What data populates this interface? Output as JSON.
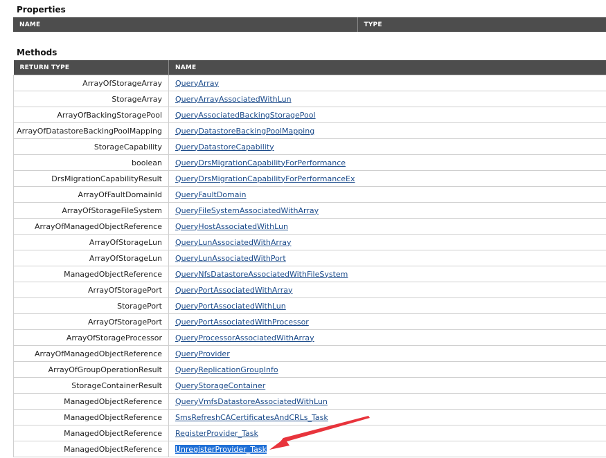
{
  "properties": {
    "title": "Properties",
    "columns": [
      "NAME",
      "TYPE"
    ]
  },
  "methods": {
    "title": "Methods",
    "columns": [
      "RETURN TYPE",
      "NAME"
    ],
    "rows": [
      {
        "return_type": "ArrayOfStorageArray",
        "name": "QueryArray"
      },
      {
        "return_type": "StorageArray",
        "name": "QueryArrayAssociatedWithLun"
      },
      {
        "return_type": "ArrayOfBackingStoragePool",
        "name": "QueryAssociatedBackingStoragePool"
      },
      {
        "return_type": "ArrayOfDatastoreBackingPoolMapping",
        "name": "QueryDatastoreBackingPoolMapping"
      },
      {
        "return_type": "StorageCapability",
        "name": "QueryDatastoreCapability"
      },
      {
        "return_type": "boolean",
        "name": "QueryDrsMigrationCapabilityForPerformance"
      },
      {
        "return_type": "DrsMigrationCapabilityResult",
        "name": "QueryDrsMigrationCapabilityForPerformanceEx"
      },
      {
        "return_type": "ArrayOfFaultDomainId",
        "name": "QueryFaultDomain"
      },
      {
        "return_type": "ArrayOfStorageFileSystem",
        "name": "QueryFileSystemAssociatedWithArray"
      },
      {
        "return_type": "ArrayOfManagedObjectReference",
        "name": "QueryHostAssociatedWithLun"
      },
      {
        "return_type": "ArrayOfStorageLun",
        "name": "QueryLunAssociatedWithArray"
      },
      {
        "return_type": "ArrayOfStorageLun",
        "name": "QueryLunAssociatedWithPort"
      },
      {
        "return_type": "ManagedObjectReference",
        "name": "QueryNfsDatastoreAssociatedWithFileSystem"
      },
      {
        "return_type": "ArrayOfStoragePort",
        "name": "QueryPortAssociatedWithArray"
      },
      {
        "return_type": "StoragePort",
        "name": "QueryPortAssociatedWithLun"
      },
      {
        "return_type": "ArrayOfStoragePort",
        "name": "QueryPortAssociatedWithProcessor"
      },
      {
        "return_type": "ArrayOfStorageProcessor",
        "name": "QueryProcessorAssociatedWithArray"
      },
      {
        "return_type": "ArrayOfManagedObjectReference",
        "name": "QueryProvider"
      },
      {
        "return_type": "ArrayOfGroupOperationResult",
        "name": "QueryReplicationGroupInfo"
      },
      {
        "return_type": "StorageContainerResult",
        "name": "QueryStorageContainer"
      },
      {
        "return_type": "ManagedObjectReference",
        "name": "QueryVmfsDatastoreAssociatedWithLun"
      },
      {
        "return_type": "ManagedObjectReference",
        "name": "SmsRefreshCACertificatesAndCRLs_Task"
      },
      {
        "return_type": "ManagedObjectReference",
        "name": "RegisterProvider_Task"
      },
      {
        "return_type": "ManagedObjectReference",
        "name": "UnregisterProvider_Task",
        "selected": true
      }
    ]
  },
  "colors": {
    "header_bg": "#4d4d4d",
    "link": "#1a4a8a",
    "selection": "#1f6fd6",
    "annotation_arrow": "#e8343c"
  }
}
